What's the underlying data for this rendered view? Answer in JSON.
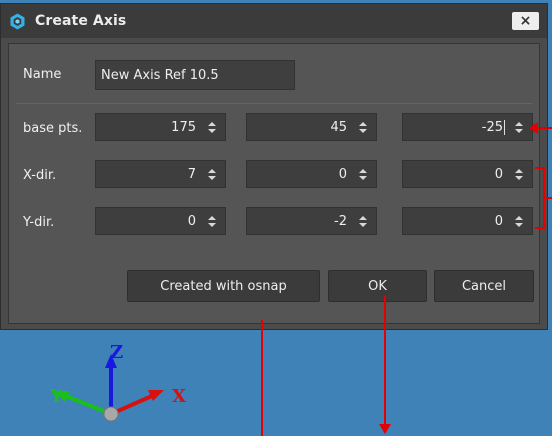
{
  "dialog": {
    "title": "Create Axis",
    "close_label": "×"
  },
  "form": {
    "name_label": "Name",
    "name_value": "New Axis Ref 10.5",
    "rows": [
      {
        "label": "base pts.",
        "values": [
          "175",
          "45",
          "-25"
        ]
      },
      {
        "label": "X-dir.",
        "values": [
          "7",
          "0",
          "0"
        ]
      },
      {
        "label": "Y-dir.",
        "values": [
          "0",
          "-2",
          "0"
        ]
      }
    ]
  },
  "buttons": {
    "osnap": "Created with osnap",
    "ok": "OK",
    "cancel": "Cancel"
  },
  "gizmo": {
    "z_label": "Z",
    "y_label": "Y",
    "x_label": "X",
    "colors": {
      "x": "#e01010",
      "y": "#10c020",
      "z": "#1010e0"
    }
  },
  "annotation_color": "#e30000"
}
